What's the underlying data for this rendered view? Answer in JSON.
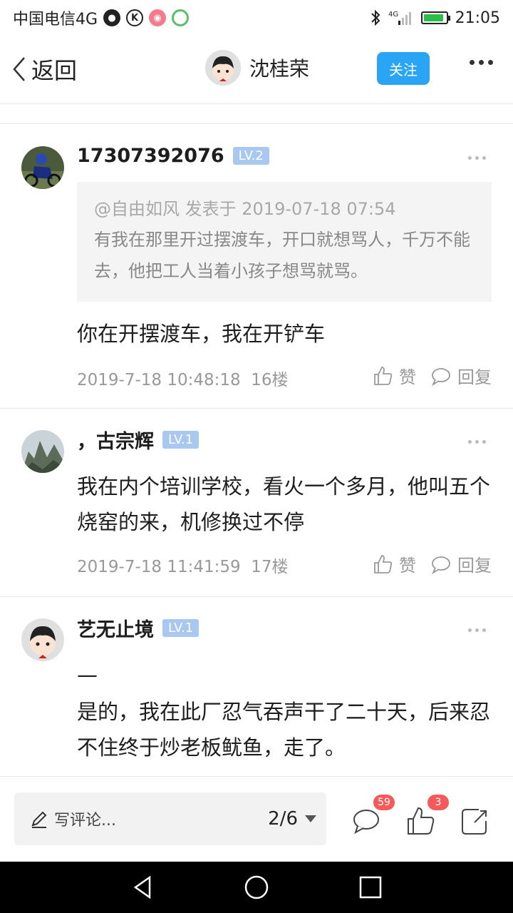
{
  "status_bar": {
    "carrier": "中国电信4G",
    "time": "21:05",
    "network": "4G"
  },
  "nav": {
    "back_label": "返回",
    "user_name": "沈桂荣",
    "follow_label": "关注"
  },
  "comments": [
    {
      "username": "17307392076",
      "level": "LV.2",
      "quote": {
        "meta": "@自由如风 发表于 2019-07-18 07:54",
        "text": "有我在那里开过摆渡车，开口就想骂人，千万不能去，他把工人当着小孩子想骂就骂。"
      },
      "body": "你在开摆渡车，我在开铲车",
      "datetime": "2019-7-18 10:48:18",
      "floor": "16楼",
      "like_label": "赞",
      "reply_label": "回复"
    },
    {
      "username": "，古宗辉",
      "level": "LV.1",
      "body": "我在内个培训学校，看火一个多月，他叫五个烧窑的来，机修换过不停",
      "datetime": "2019-7-18 11:41:59",
      "floor": "17楼",
      "like_label": "赞",
      "reply_label": "回复"
    },
    {
      "username": "艺无止境",
      "level": "LV.1",
      "body_line1": "—",
      "body": "是的，我在此厂忍气吞声干了二十天，后来忍不住终于炒老板鱿鱼，走了。"
    }
  ],
  "bottom_bar": {
    "comment_placeholder": "写评论...",
    "page_indicator": "2/6",
    "comment_count": "59",
    "like_count": "3"
  },
  "colors": {
    "accent": "#2aa4f4",
    "badge": "#f55a5a",
    "level_badge": "#a9c8f0"
  }
}
